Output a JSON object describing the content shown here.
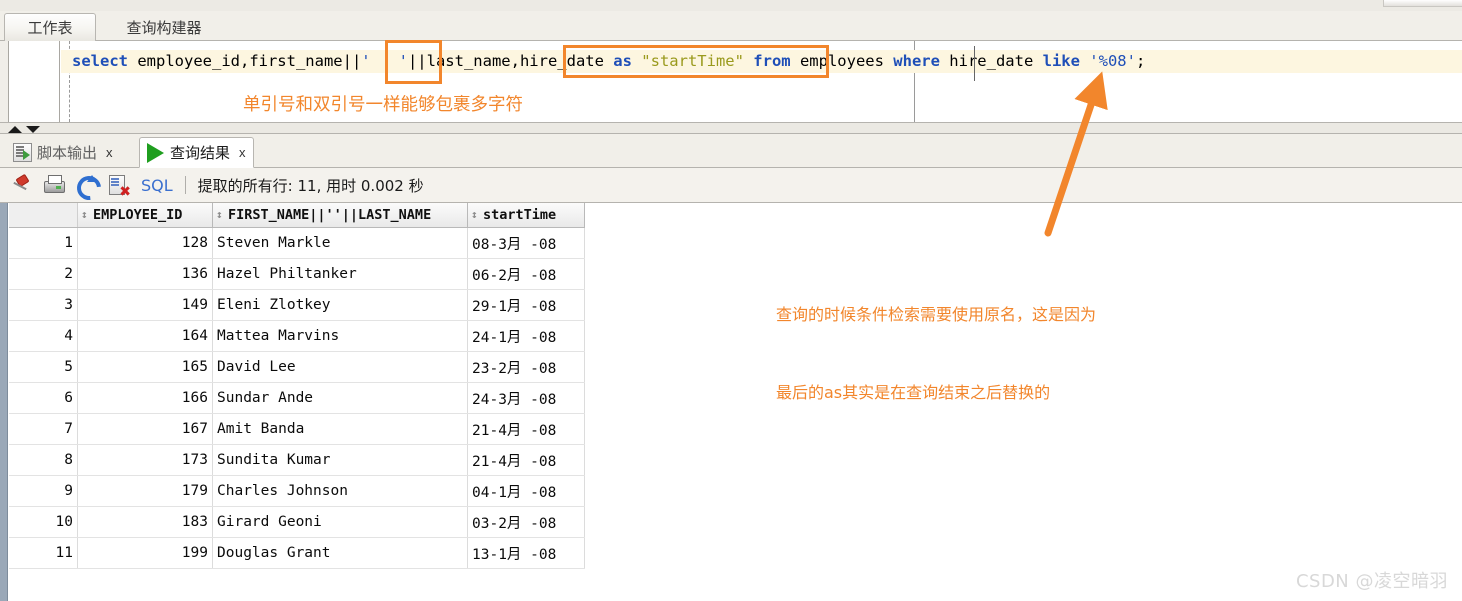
{
  "window": {
    "worksheet_tabs": [
      {
        "label": "工作表",
        "active": true
      },
      {
        "label": "查询构建器",
        "active": false
      }
    ]
  },
  "editor": {
    "sql_tokens": [
      {
        "t": "select",
        "c": "kw"
      },
      {
        "t": " employee_id,first_name||",
        "c": "plain"
      },
      {
        "t": "'   '",
        "c": "str"
      },
      {
        "t": "||last_name,hire_date ",
        "c": "plain"
      },
      {
        "t": "as",
        "c": "kw"
      },
      {
        "t": " ",
        "c": "plain"
      },
      {
        "t": "\"startTime\"",
        "c": "dstr"
      },
      {
        "t": " ",
        "c": "plain"
      },
      {
        "t": "from",
        "c": "kw"
      },
      {
        "t": " employees ",
        "c": "plain"
      },
      {
        "t": "where",
        "c": "kw"
      },
      {
        "t": " hire_date ",
        "c": "plain"
      },
      {
        "t": "like",
        "c": "kw"
      },
      {
        "t": " ",
        "c": "plain"
      },
      {
        "t": "'%08'",
        "c": "str"
      },
      {
        "t": ";",
        "c": "plain"
      }
    ],
    "sql_plain": "select employee_id,first_name||'   '||last_name,hire_date as \"startTime\" from employees where hire_date like '%08';"
  },
  "result_tabs": [
    {
      "label": "脚本输出",
      "close": "x",
      "icon": "script-output-icon",
      "active": false
    },
    {
      "label": "查询结果",
      "close": "x",
      "icon": "play-icon",
      "active": true
    }
  ],
  "toolbar": {
    "icons": [
      "pin-icon",
      "print-icon",
      "refresh-icon",
      "clear-results-icon"
    ],
    "sql_label": "SQL",
    "status": "提取的所有行: 11, 用时 0.002 秒"
  },
  "grid": {
    "columns": [
      "",
      "EMPLOYEE_ID",
      "FIRST_NAME||''||LAST_NAME",
      "startTime"
    ],
    "rows": [
      {
        "n": "1",
        "employee_id": "128",
        "name": "Steven   Markle",
        "start": "08-3月 -08"
      },
      {
        "n": "2",
        "employee_id": "136",
        "name": "Hazel    Philtanker",
        "start": "06-2月 -08"
      },
      {
        "n": "3",
        "employee_id": "149",
        "name": "Eleni    Zlotkey",
        "start": "29-1月 -08"
      },
      {
        "n": "4",
        "employee_id": "164",
        "name": "Mattea   Marvins",
        "start": "24-1月 -08"
      },
      {
        "n": "5",
        "employee_id": "165",
        "name": "David    Lee",
        "start": "23-2月 -08"
      },
      {
        "n": "6",
        "employee_id": "166",
        "name": "Sundar   Ande",
        "start": "24-3月 -08"
      },
      {
        "n": "7",
        "employee_id": "167",
        "name": "Amit     Banda",
        "start": "21-4月 -08"
      },
      {
        "n": "8",
        "employee_id": "173",
        "name": "Sundita  Kumar",
        "start": "21-4月 -08"
      },
      {
        "n": "9",
        "employee_id": "179",
        "name": "Charles  Johnson",
        "start": "04-1月 -08"
      },
      {
        "n": "10",
        "employee_id": "183",
        "name": "Girard   Geoni",
        "start": "03-2月 -08"
      },
      {
        "n": "11",
        "employee_id": "199",
        "name": "Douglas  Grant",
        "start": "13-1月 -08"
      }
    ]
  },
  "annotations": {
    "quote_note": "单引号和双引号一样能够包裹多字符",
    "alias_note_line1": "查询的时候条件检索需要使用原名，这是因为",
    "alias_note_line2": "最后的as其实是在查询结束之后替换的",
    "accent_color": "#f2862c"
  },
  "watermark": "CSDN @凌空暗羽"
}
